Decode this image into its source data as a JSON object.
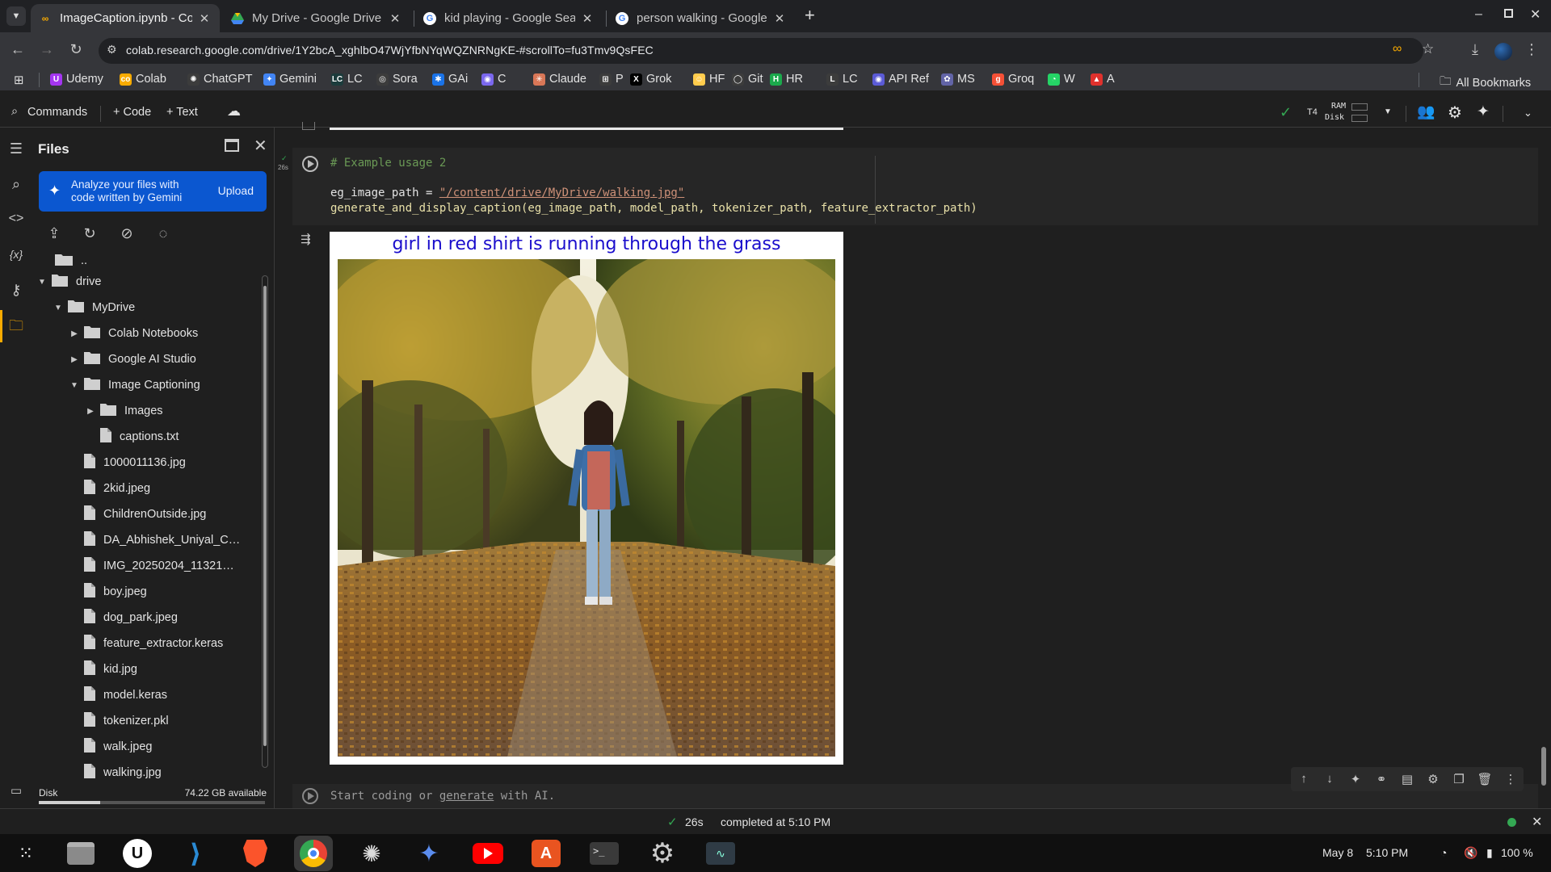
{
  "browser": {
    "tabs": [
      {
        "title": "ImageCaption.ipynb - Co",
        "icon": "colab-icon",
        "active": true
      },
      {
        "title": "My Drive - Google Drive",
        "icon": "google-drive-icon",
        "active": false
      },
      {
        "title": "kid playing - Google Sear",
        "icon": "google-icon",
        "active": false
      },
      {
        "title": "person walking - Google",
        "icon": "google-icon",
        "active": false
      }
    ],
    "new_tab": "+",
    "url": "colab.research.google.com/drive/1Y2bcA_xghlbO47WjYfbNYqWQZNRNgKE-#scrollTo=fu3Tmv9QsFEC"
  },
  "bookmarks": [
    {
      "label": "Udemy",
      "color": "#a435f0",
      "glyph": "U"
    },
    {
      "label": "Colab",
      "color": "#f9ab00",
      "glyph": "co"
    },
    {
      "label": "ChatGPT",
      "color": "#3c3c3c",
      "glyph": "✺"
    },
    {
      "label": "Gemini",
      "color": "#4285f4",
      "glyph": "✦"
    },
    {
      "label": "LC",
      "color": "#1c3c3c",
      "glyph": "LC"
    },
    {
      "label": "Sora",
      "color": "#3c3c3c",
      "glyph": "◎"
    },
    {
      "label": "GAi",
      "color": "#1a73e8",
      "glyph": "✱"
    },
    {
      "label": "C",
      "color": "#7b68ee",
      "glyph": "◉"
    },
    {
      "label": "Claude",
      "color": "#d97757",
      "glyph": "✳"
    },
    {
      "label": "P",
      "color": "#3c3c3c",
      "glyph": "⊞"
    },
    {
      "label": "Grok",
      "color": "#000000",
      "glyph": "X"
    },
    {
      "label": "HF",
      "color": "#ffcc4d",
      "glyph": "☺"
    },
    {
      "label": "Git",
      "color": "#3c3c3c",
      "glyph": "◯"
    },
    {
      "label": "HR",
      "color": "#1ba94c",
      "glyph": "H"
    },
    {
      "label": "LC",
      "color": "#3c3c3c",
      "glyph": "L"
    },
    {
      "label": "API Ref",
      "color": "#5b5bd6",
      "glyph": "◉"
    },
    {
      "label": "MS",
      "color": "#6264a7",
      "glyph": "✿"
    },
    {
      "label": "Groq",
      "color": "#f55036",
      "glyph": "g"
    },
    {
      "label": "W",
      "color": "#25d366",
      "glyph": "◔"
    },
    {
      "label": "A",
      "color": "#e0312d",
      "glyph": "▲"
    }
  ],
  "all_bookmarks": "All Bookmarks",
  "colab_toolbar": {
    "commands": "Commands",
    "code": "+ Code",
    "text": "+ Text",
    "runtime": "T4",
    "ram": "RAM",
    "disk": "Disk"
  },
  "files_panel": {
    "title": "Files",
    "gemini_text": "Analyze your files with code written by Gemini",
    "upload": "Upload",
    "parent": "..",
    "tree": [
      {
        "name": "drive",
        "type": "folder",
        "level": 0,
        "caret": "down"
      },
      {
        "name": "MyDrive",
        "type": "folder",
        "level": 1,
        "caret": "down"
      },
      {
        "name": "Colab Notebooks",
        "type": "folder",
        "level": 2,
        "caret": "right"
      },
      {
        "name": "Google AI Studio",
        "type": "folder",
        "level": 2,
        "caret": "right"
      },
      {
        "name": "Image Captioning",
        "type": "folder",
        "level": 2,
        "caret": "down"
      },
      {
        "name": "Images",
        "type": "folder",
        "level": 3,
        "caret": "right"
      },
      {
        "name": "captions.txt",
        "type": "file",
        "level": 3,
        "caret": "none"
      },
      {
        "name": "1000011136.jpg",
        "type": "file",
        "level": 2,
        "caret": "none"
      },
      {
        "name": "2kid.jpeg",
        "type": "file",
        "level": 2,
        "caret": "none"
      },
      {
        "name": "ChildrenOutside.jpg",
        "type": "file",
        "level": 2,
        "caret": "none"
      },
      {
        "name": "DA_Abhishek_Uniyal_C…",
        "type": "file",
        "level": 2,
        "caret": "none"
      },
      {
        "name": "IMG_20250204_11321…",
        "type": "file",
        "level": 2,
        "caret": "none"
      },
      {
        "name": "boy.jpeg",
        "type": "file",
        "level": 2,
        "caret": "none"
      },
      {
        "name": "dog_park.jpeg",
        "type": "file",
        "level": 2,
        "caret": "none"
      },
      {
        "name": "feature_extractor.keras",
        "type": "file",
        "level": 2,
        "caret": "none"
      },
      {
        "name": "kid.jpg",
        "type": "file",
        "level": 2,
        "caret": "none"
      },
      {
        "name": "model.keras",
        "type": "file",
        "level": 2,
        "caret": "none"
      },
      {
        "name": "tokenizer.pkl",
        "type": "file",
        "level": 2,
        "caret": "none"
      },
      {
        "name": "walk.jpeg",
        "type": "file",
        "level": 2,
        "caret": "none"
      },
      {
        "name": "walking.jpg",
        "type": "file",
        "level": 2,
        "caret": "none"
      }
    ],
    "disk_label": "Disk",
    "disk_available": "74.22 GB available",
    "disk_used_fraction": 0.27
  },
  "cell": {
    "exec_time": "26s",
    "comment": "# Example usage 2",
    "line2_pre": "eg_image_path = ",
    "line2_str": "\"/content/drive/MyDrive/walking.jpg\"",
    "line3": "generate_and_display_caption(eg_image_path, model_path, tokenizer_path, feature_extractor_path)",
    "output_caption": "girl in red shirt is running through the grass"
  },
  "new_cell": {
    "pre": "Start coding or ",
    "link": "generate",
    "post": " with AI."
  },
  "status": {
    "time": "26s",
    "completed": "completed at 5:10 PM"
  },
  "taskbar": {
    "date": "May 8",
    "time": "5:10 PM",
    "battery": "100 %"
  }
}
